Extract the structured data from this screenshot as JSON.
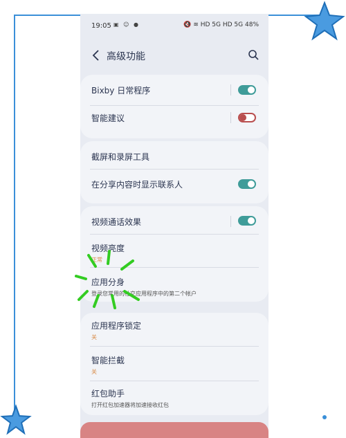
{
  "status_bar": {
    "time": "19:05",
    "left_icons": "▣ ☺ ●",
    "right_text": "🔇 ≋ HD 5G HD 5G 48%"
  },
  "header": {
    "title": "高级功能"
  },
  "settings": {
    "bixby_routines": {
      "label": "Bixby 日常程序"
    },
    "smart_suggestions": {
      "label": "智能建议"
    },
    "screenshots_tool": {
      "label": "截屏和录屏工具"
    },
    "share_contacts": {
      "label": "在分享内容时显示联系人"
    },
    "video_call_effects": {
      "label": "视频通话效果"
    },
    "video_brightness": {
      "label": "视频亮度",
      "sub": "正常"
    },
    "dual_messenger": {
      "label": "应用分身",
      "sub": "登录您常用的社交应用程序中的第二个帐户"
    },
    "app_lock": {
      "label": "应用程序锁定",
      "sub": "关"
    },
    "smart_block": {
      "label": "智能拦截",
      "sub": "关"
    },
    "red_packet": {
      "label": "红包助手",
      "sub": "打开红包加速器将加速接收红包"
    }
  },
  "colors": {
    "toggle_on": "#3f9c99",
    "toggle_off": "#b94e4e",
    "accent_sub": "#d88b48",
    "highlight": "#33cc22",
    "frame": "#3a8fd8"
  },
  "toggles": {
    "bixby_routines": true,
    "smart_suggestions": false,
    "share_contacts": true,
    "video_call_effects": true
  }
}
